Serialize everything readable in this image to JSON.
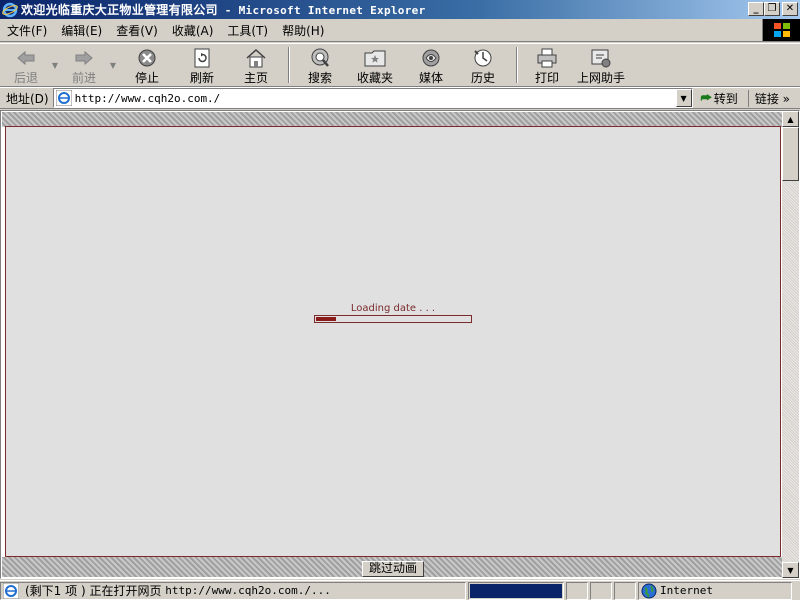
{
  "window": {
    "title_cn": "欢迎光临重庆大正物业管理有限公司",
    "title_sep": " - ",
    "title_app": "Microsoft Internet Explorer",
    "minimize": "_",
    "restore": "❐",
    "close": "✕"
  },
  "menu": [
    "文件(F)",
    "编辑(E)",
    "查看(V)",
    "收藏(A)",
    "工具(T)",
    "帮助(H)"
  ],
  "toolbar": {
    "back": "后退",
    "forward": "前进",
    "stop": "停止",
    "refresh": "刷新",
    "home": "主页",
    "search": "搜索",
    "favorites": "收藏夹",
    "media": "媒体",
    "history": "历史",
    "print": "打印",
    "online_help": "上网助手"
  },
  "address": {
    "label": "地址(D)",
    "url": "http://www.cqh2o.com./",
    "go": "转到",
    "links": "链接",
    "links_more": "»"
  },
  "page": {
    "loading_text": "Loading date . . .",
    "progress": 0.14,
    "skip_label": "跳过动画"
  },
  "status": {
    "text_prefix": "(剩下1 项 ) 正在打开网页 ",
    "text_url": "http://www.cqh2o.com./...",
    "progress": 1.0,
    "zone": "Internet"
  },
  "colors": {
    "titlebar": "#0a246a",
    "accent": "#7a2b2b",
    "loading_fill": "#8b1a1a",
    "status_progress": "#0a246a"
  }
}
